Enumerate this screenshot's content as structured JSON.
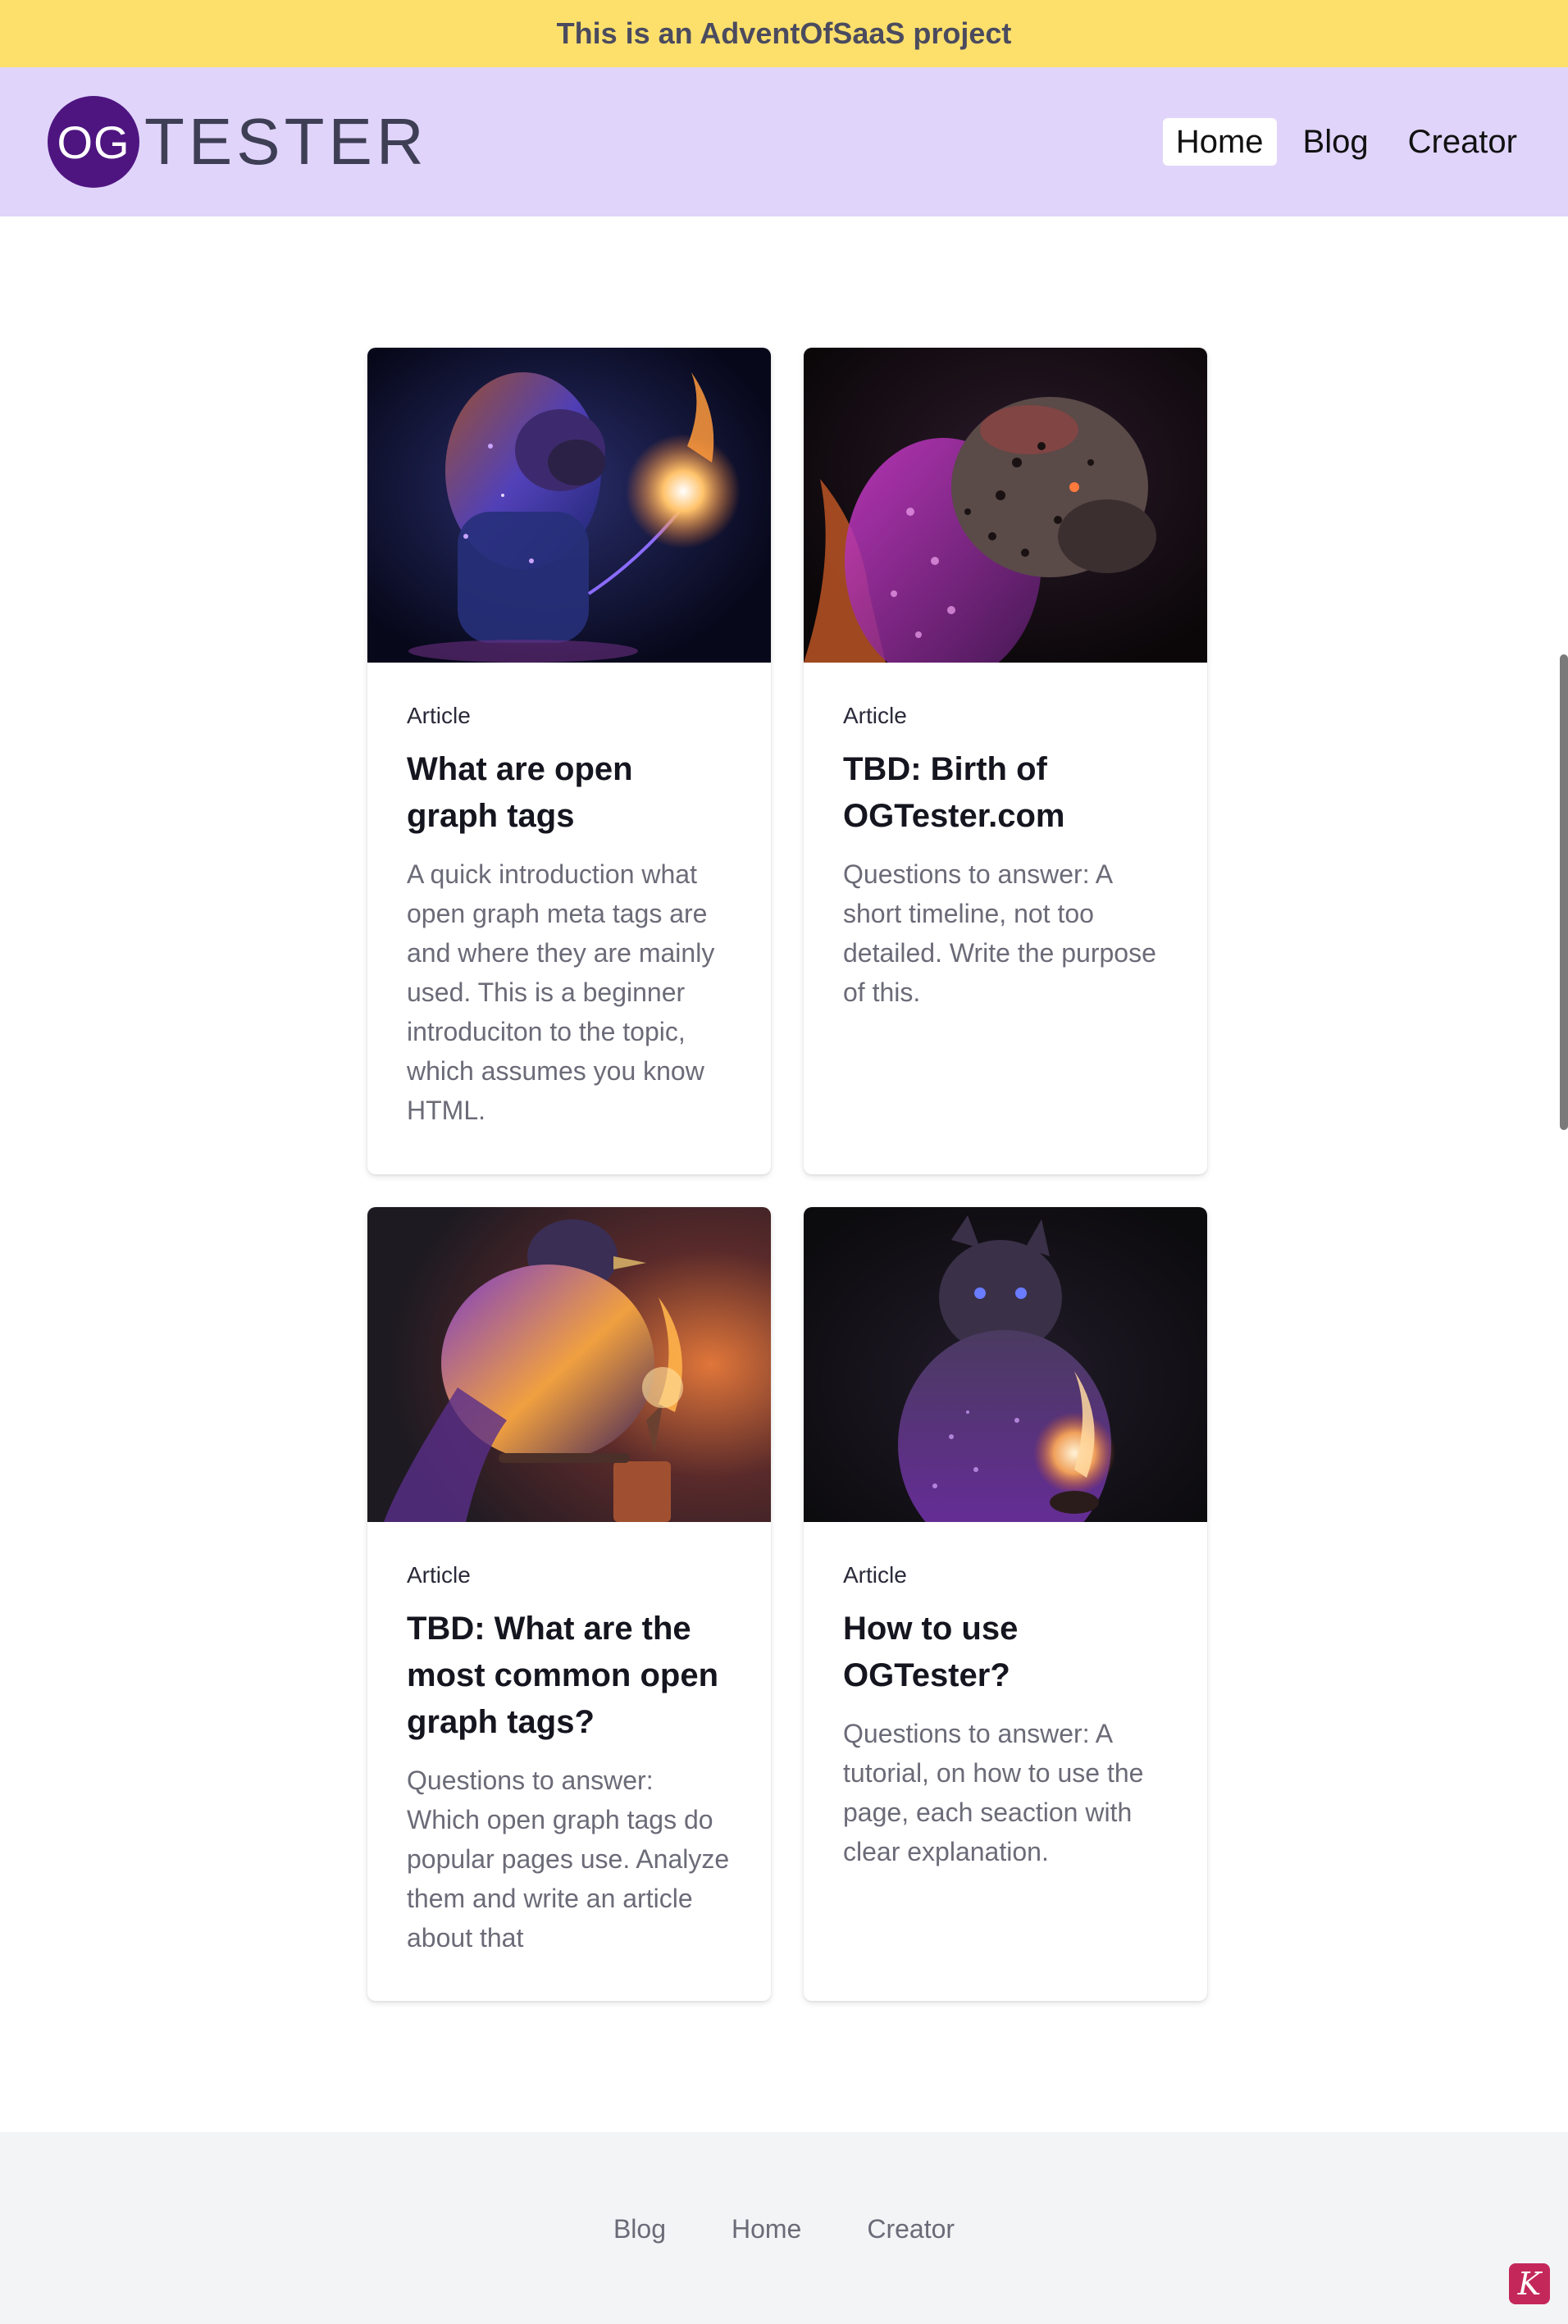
{
  "banner": {
    "text": "This is an AdventOfSaaS project"
  },
  "header": {
    "logo_circle": "OG",
    "logo_text": "TESTER",
    "nav": [
      {
        "label": "Home",
        "active": true
      },
      {
        "label": "Blog",
        "active": false
      },
      {
        "label": "Creator",
        "active": false
      }
    ]
  },
  "cards": [
    {
      "tag": "Article",
      "title": "What are open graph tags",
      "description": "A quick introduction what open graph meta tags are and where they are mainly used. This is a beginner introduciton to the topic, which assumes you know HTML.",
      "image": "lion-with-flame-image"
    },
    {
      "tag": "Article",
      "title": "TBD: Birth of OGTester.com",
      "description": "Questions to answer: A short timeline, not too detailed. Write the purpose of this.",
      "image": "leopard-with-fire-image"
    },
    {
      "tag": "Article",
      "title": "TBD: What are the most common open graph tags?",
      "description": "Questions to answer: Which open graph tags do popular pages use. Analyze them and write an article about that",
      "image": "bird-with-torch-image"
    },
    {
      "tag": "Article",
      "title": "How to use OGTester?",
      "description": "Questions to answer: A tutorial, on how to use the page, each seaction with clear explanation.",
      "image": "cat-with-candle-image"
    }
  ],
  "footer": {
    "links": [
      "Blog",
      "Home",
      "Creator"
    ]
  },
  "badge": {
    "text": "K"
  },
  "colors": {
    "banner_bg": "#fde06b",
    "header_bg": "#e0d4fb",
    "logo_circle_bg": "#4e1580",
    "footer_bg": "#f3f4f6",
    "badge_bg": "#c4285a"
  }
}
